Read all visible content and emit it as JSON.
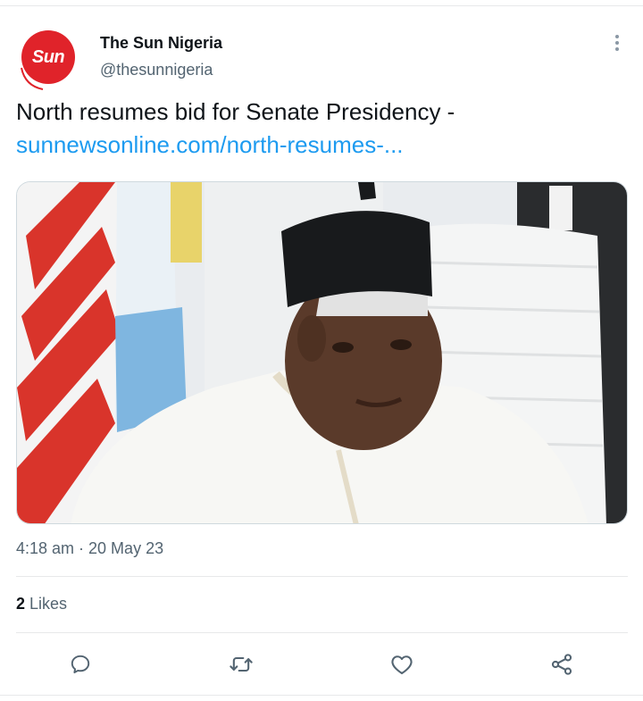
{
  "tweet": {
    "account_name": "The Sun Nigeria",
    "handle": "@thesunnigeria",
    "avatar_text": "Sun",
    "text": "North resumes bid for Senate Presidency -",
    "link": "sunnewsonline.com/north-resumes-...",
    "timestamp": "4:18 am · 20 May 23",
    "likes_count": "2",
    "likes_label": " Likes"
  },
  "actions": {
    "reply_icon": "reply-icon",
    "retweet_icon": "retweet-icon",
    "like_icon": "heart-icon",
    "share_icon": "share-icon"
  },
  "colors": {
    "brand_red": "#e0232a",
    "link_blue": "#1d9bf0",
    "secondary_text": "#536471",
    "icon_gray": "#536471"
  }
}
